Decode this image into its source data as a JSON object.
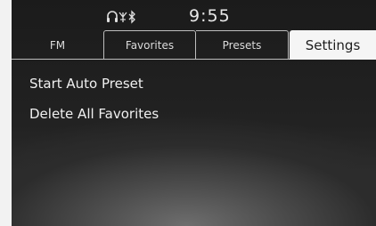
{
  "status_bar": {
    "clock": "9:55",
    "icons": [
      "headphone-icon",
      "signal-icon",
      "bluetooth-icon"
    ]
  },
  "tabs": [
    {
      "label": "FM",
      "active": false
    },
    {
      "label": "Favorites",
      "active": false
    },
    {
      "label": "Presets",
      "active": false
    },
    {
      "label": "Settings",
      "active": true
    }
  ],
  "menu": {
    "items": [
      {
        "label": "Start Auto Preset"
      },
      {
        "label": "Delete All Favorites"
      }
    ]
  },
  "colors": {
    "background": "#1e1e1e",
    "active_tab": "#f5f5f5",
    "text": "#f0f0f0"
  }
}
